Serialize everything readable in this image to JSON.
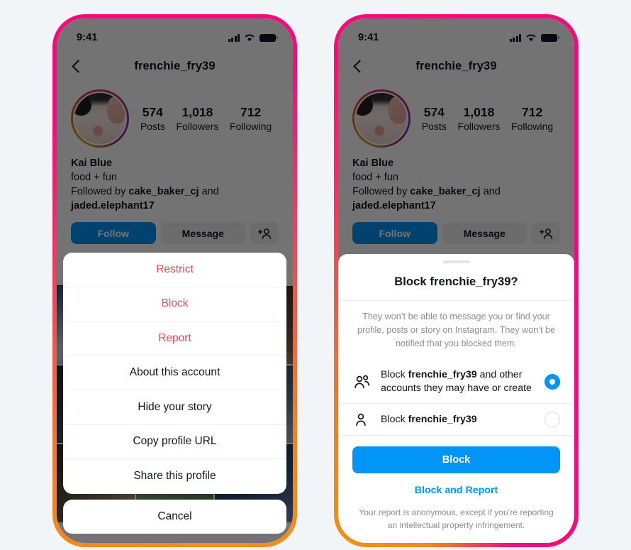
{
  "status_bar": {
    "time": "9:41",
    "signal_icon": "cellular-bars-icon",
    "wifi_icon": "wifi-icon",
    "battery_icon": "battery-icon"
  },
  "nav": {
    "back_icon": "back-chevron-icon",
    "title": "frenchie_fry39"
  },
  "profile": {
    "avatar_icon": "profile-avatar",
    "stats": [
      {
        "number": "574",
        "label": "Posts"
      },
      {
        "number": "1,018",
        "label": "Followers"
      },
      {
        "number": "712",
        "label": "Following"
      }
    ],
    "name": "Kai Blue",
    "bio": "food + fun",
    "followed_by_prefix": "Followed by ",
    "followed_by_user1": "cake_baker_cj",
    "followed_by_middle": " and ",
    "followed_by_user2": "jaded.elephant17",
    "buttons": {
      "follow": "Follow",
      "message": "Message",
      "add_user_icon": "add-person-icon"
    },
    "tabs": [
      {
        "icon": "grid-icon",
        "active": true
      },
      {
        "icon": "tagged-photos-icon",
        "active": false
      }
    ]
  },
  "action_sheet": {
    "items": [
      {
        "label": "Restrict",
        "style": "danger"
      },
      {
        "label": "Block",
        "style": "danger"
      },
      {
        "label": "Report",
        "style": "danger"
      },
      {
        "label": "About this account",
        "style": "normal"
      },
      {
        "label": "Hide your story",
        "style": "normal"
      },
      {
        "label": "Copy profile URL",
        "style": "normal"
      },
      {
        "label": "Share this profile",
        "style": "normal"
      }
    ],
    "cancel": "Cancel"
  },
  "block_modal": {
    "drag_handle_icon": "drag-handle",
    "title": "Block frenchie_fry39?",
    "description": "They won’t be able to message you or find your profile, posts or story on Instagram. They won’t be notified that you blocked them.",
    "options": [
      {
        "icon": "people-group-icon",
        "text_prefix": "Block ",
        "text_bold": "frenchie_fry39",
        "text_suffix": " and other accounts they may have or create",
        "selected": true
      },
      {
        "icon": "person-icon",
        "text_prefix": "Block ",
        "text_bold": "frenchie_fry39",
        "text_suffix": "",
        "selected": false
      }
    ],
    "primary_button": "Block",
    "secondary_link": "Block and Report",
    "footer": "Your report is anonymous, except if you’re reporting an intellectual property infringement."
  },
  "colors": {
    "accent_blue": "#0095f6",
    "danger_red": "#ed4956",
    "frame_pink": "#f40b7c",
    "frame_orange": "#f58e16",
    "page_bg": "#f2f5f8"
  }
}
